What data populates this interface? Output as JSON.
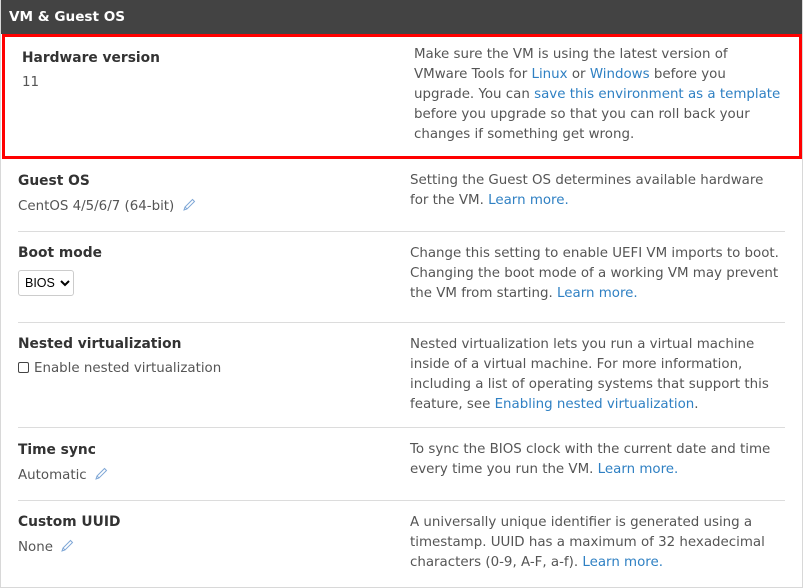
{
  "header": {
    "title": "VM & Guest OS"
  },
  "rows": {
    "hardware": {
      "label": "Hardware version",
      "value": "11",
      "desc_1": "Make sure the VM is using the latest version of VMware Tools for ",
      "link_linux": "Linux",
      "desc_2": " or ",
      "link_windows": "Windows",
      "desc_3": " before you upgrade. You can ",
      "link_template": "save this environment as a template",
      "desc_4": " before you upgrade so that you can roll back your changes if something get wrong."
    },
    "guest_os": {
      "label": "Guest OS",
      "value": "CentOS 4/5/6/7 (64-bit)",
      "desc": "Setting the Guest OS determines available hardware for the VM. ",
      "link": "Learn more."
    },
    "boot_mode": {
      "label": "Boot mode",
      "selected": "BIOS",
      "desc": "Change this setting to enable UEFI VM imports to boot. Changing the boot mode of a working VM may prevent the VM from starting. ",
      "link": "Learn more."
    },
    "nested": {
      "label": "Nested virtualization",
      "checkbox_label": "Enable nested virtualization",
      "checked": false,
      "desc": "Nested virtualization lets you run a virtual machine inside of a virtual machine. For more information, including a list of operating systems that support this feature, see ",
      "link": "Enabling nested virtualization",
      "desc_end": "."
    },
    "time_sync": {
      "label": "Time sync",
      "value": "Automatic",
      "desc": "To sync the BIOS clock with the current date and time every time you run the VM. ",
      "link": "Learn more."
    },
    "uuid": {
      "label": "Custom UUID",
      "value": "None",
      "desc": "A universally unique identifier is generated using a timestamp. UUID has a maximum of 32 hexadecimal characters (0-9, A-F, a-f). ",
      "link": "Learn more."
    }
  },
  "colors": {
    "highlight": "#ff0000",
    "link": "#2f80c3",
    "header_bg": "#434343"
  }
}
